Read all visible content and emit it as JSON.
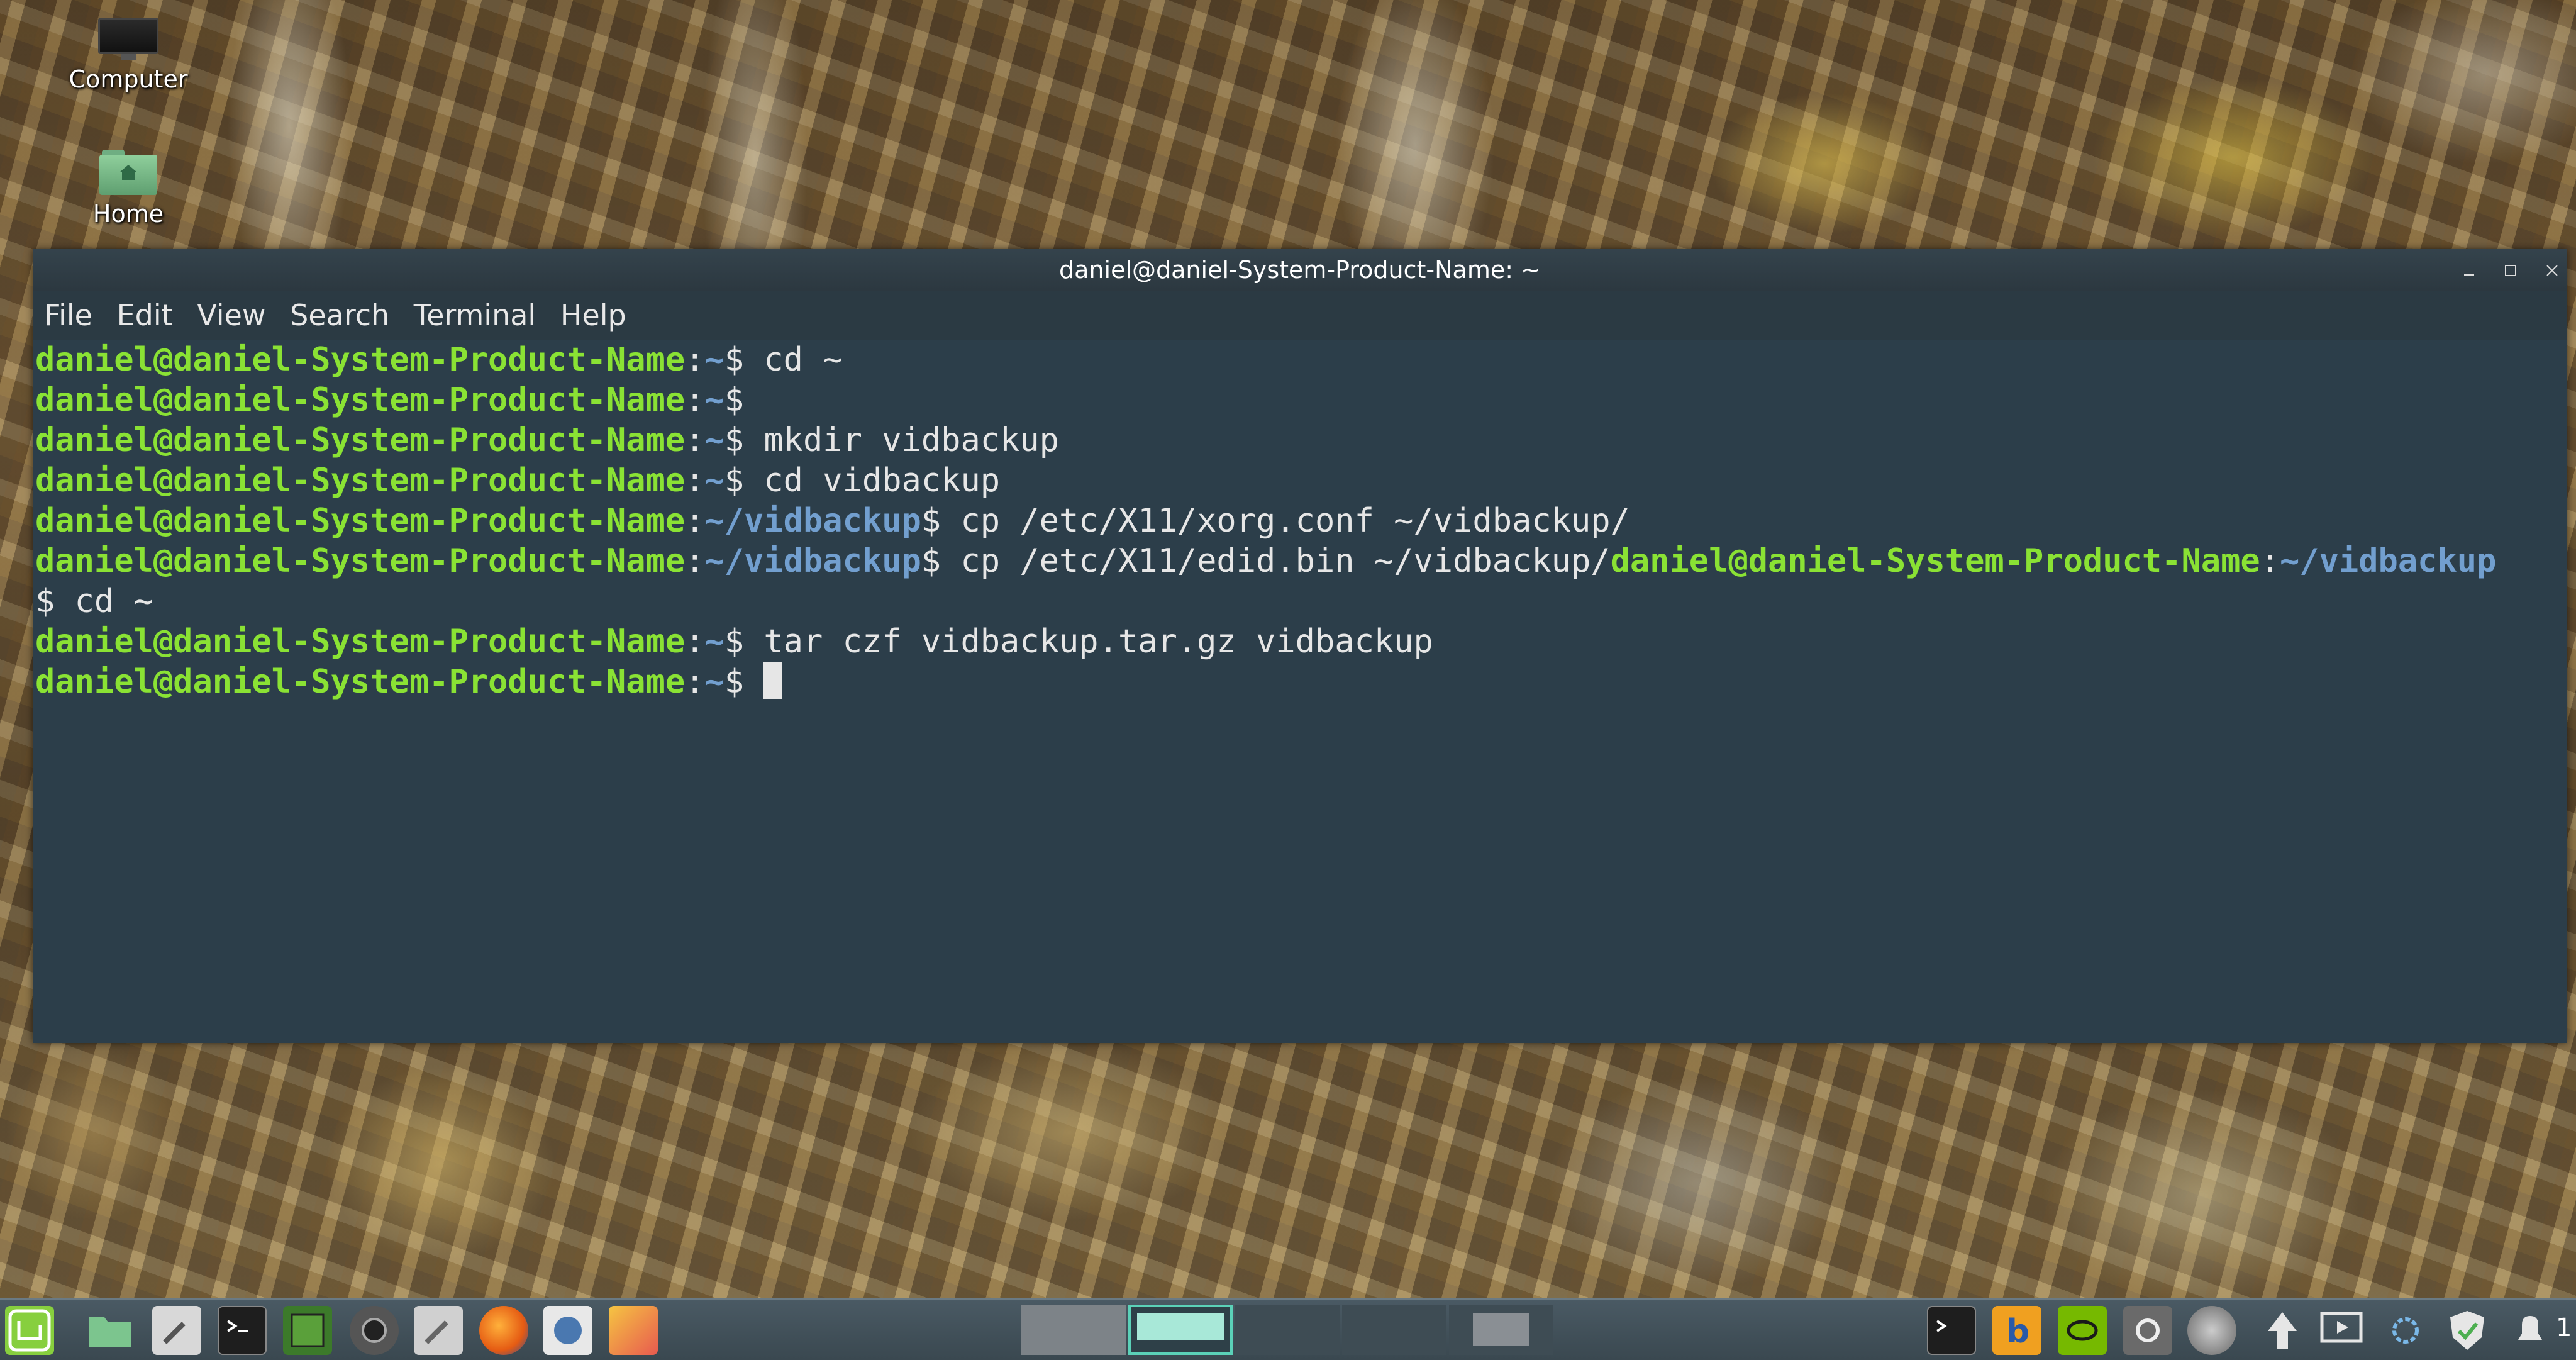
{
  "desktop": {
    "icons": [
      {
        "label": "Computer"
      },
      {
        "label": "Home"
      }
    ]
  },
  "terminal": {
    "title": "daniel@daniel-System-Product-Name: ~",
    "menu": [
      "File",
      "Edit",
      "View",
      "Search",
      "Terminal",
      "Help"
    ],
    "user_host": "daniel@daniel-System-Product-Name",
    "lines": [
      {
        "path": "~",
        "prompt": "$ ",
        "cmd": "cd ~"
      },
      {
        "path": "~",
        "prompt": "$ ",
        "cmd": ""
      },
      {
        "path": "~",
        "prompt": "$ ",
        "cmd": "mkdir vidbackup"
      },
      {
        "path": "~",
        "prompt": "$ ",
        "cmd": "cd vidbackup"
      },
      {
        "path": "~/vidbackup",
        "prompt": "$ ",
        "cmd": "cp /etc/X11/xorg.conf ~/vidbackup/"
      },
      {
        "path": "~/vidbackup",
        "prompt": "$ ",
        "cmd": "cp /etc/X11/edid.bin ~/vidbackup/"
      },
      {
        "wrap_user": "daniel@daniel-System-Product-Name",
        "wrap_path": "~/vidbackup"
      },
      {
        "cont": "$ cd ~"
      },
      {
        "path": "~",
        "prompt": "$ ",
        "cmd": "tar czf vidbackup.tar.gz vidbackup"
      },
      {
        "path": "~",
        "prompt": "$ ",
        "cmd": ""
      }
    ]
  },
  "taskbar": {
    "launchers": [
      "mint-menu-icon",
      "files-icon",
      "settings-tool-icon",
      "terminal-icon",
      "system-monitor-icon",
      "camera-icon",
      "tools-icon",
      "firefox-icon",
      "mail-icon",
      "color-app-icon"
    ],
    "workspaces": [
      "Workspace 1",
      "Workspace 2",
      "Workspace 3",
      "Workspace 4",
      "Workspace 5"
    ],
    "tray": [
      "terminal-tray-icon",
      "bluetooth-icon",
      "nvidia-icon",
      "settings-tray-icon",
      "network-pro-icon",
      "update-arrow-icon",
      "screen-icon",
      "network-gear-icon",
      "shield-check-icon",
      "notification-bell-icon"
    ],
    "notification_count": "1"
  }
}
